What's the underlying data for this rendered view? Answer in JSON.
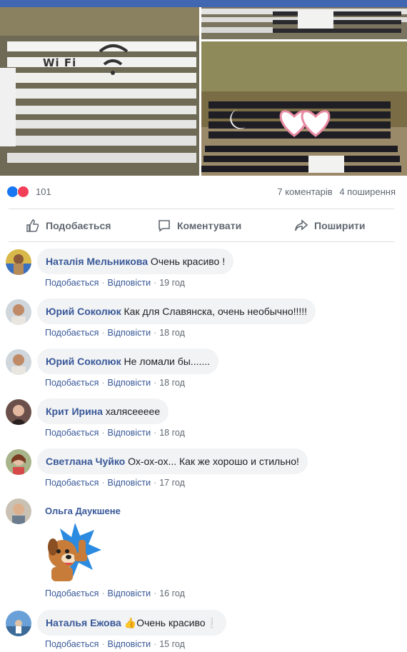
{
  "post": {
    "reactions": {
      "count": "101",
      "icons": [
        "like-icon",
        "love-icon"
      ]
    },
    "comments_count": "7 коментарів",
    "shares_count": "4 поширення"
  },
  "actions": {
    "like": "Подобається",
    "comment": "Коментувати",
    "share": "Поширити"
  },
  "photos": {
    "wifi_text": "Wi Fi"
  },
  "comment_links": {
    "like": "Подобається",
    "reply": "Відповісти"
  },
  "comments": [
    {
      "name": "Наталія Мельникова",
      "text": "Очень красиво !",
      "time": "19 год"
    },
    {
      "name": "Юрий Соколюк",
      "text": "Как для Славянска, очень необычно!!!!!",
      "time": "18 год"
    },
    {
      "name": "Юрий Соколюк",
      "text": "Не ломали бы.......",
      "time": "18 год"
    },
    {
      "name": "Крит Ирина",
      "text": "халясеееее",
      "time": "18 год"
    },
    {
      "name": "Светлана Чуйко",
      "text": "Ох-ох-ох... Как же хорошо и стильно!",
      "time": "17 год"
    },
    {
      "name": "Ольга Даукшене",
      "text": "",
      "time": "16 год",
      "sticker": "dog-thumbs-up-sticker"
    },
    {
      "name": "Наталья Ежова",
      "text": "👍Очень красиво❕",
      "time": "15 год"
    }
  ],
  "colors": {
    "facebook_blue": "#4267b2",
    "name_link": "#385898",
    "bubble_bg": "#f2f3f5",
    "love_red": "#f33e58"
  }
}
